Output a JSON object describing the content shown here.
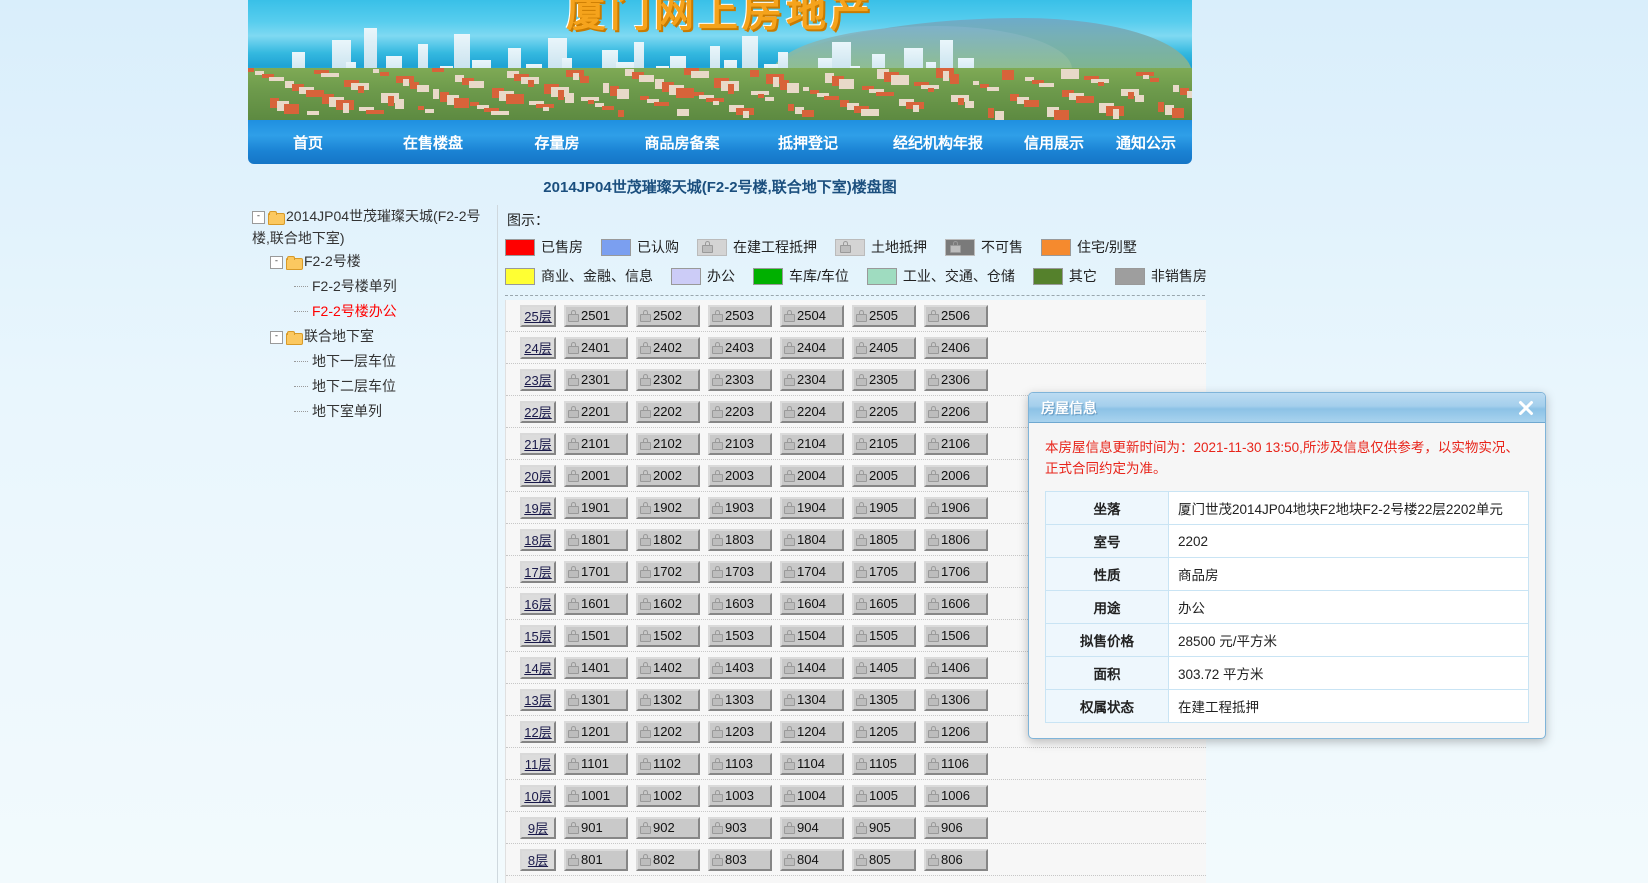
{
  "banner": {
    "title": "厦门网上房地产"
  },
  "nav": {
    "items": [
      {
        "label": "首页",
        "name": "nav-home"
      },
      {
        "label": "在售楼盘",
        "name": "nav-on-sale"
      },
      {
        "label": "存量房",
        "name": "nav-stock-housing"
      },
      {
        "label": "商品房备案",
        "name": "nav-commercial-filing"
      },
      {
        "label": "抵押登记",
        "name": "nav-mortgage-registration"
      },
      {
        "label": "经纪机构年报",
        "name": "nav-agency-annual-report"
      },
      {
        "label": "信用展示",
        "name": "nav-credit-display"
      },
      {
        "label": "通知公示",
        "name": "nav-notices"
      }
    ]
  },
  "page": {
    "title": "2014JP04世茂璀璨天城(F2-2号楼,联合地下室)楼盘图"
  },
  "tree": {
    "root": "2014JP04世茂璀璨天城(F2-2号楼,联合地下室)",
    "expand_glyph": "-",
    "nodes": [
      {
        "label": "F2-2号楼",
        "type": "folder"
      },
      {
        "label": "F2-2号楼单列",
        "type": "leaf",
        "active": false
      },
      {
        "label": "F2-2号楼办公",
        "type": "leaf",
        "active": true
      },
      {
        "label": "联合地下室",
        "type": "folder"
      },
      {
        "label": "地下一层车位",
        "type": "leaf",
        "active": false
      },
      {
        "label": "地下二层车位",
        "type": "leaf",
        "active": false
      },
      {
        "label": "地下室单列",
        "type": "leaf",
        "active": false
      }
    ]
  },
  "legend": {
    "title": "图示：",
    "row1": [
      {
        "label": "已售房",
        "color": "#ff0000",
        "icon": "swatch"
      },
      {
        "label": "已认购",
        "color": "#7b9ff0",
        "icon": "swatch"
      },
      {
        "label": "在建工程抵押",
        "color": "#d4d4d4",
        "icon": "lock-icon"
      },
      {
        "label": "土地抵押",
        "color": "#d4d4d4",
        "icon": "lock-icon"
      },
      {
        "label": "不可售",
        "color": "#7a7a7a",
        "icon": "lock-icon"
      },
      {
        "label": "住宅/别墅",
        "color": "#f58a2e",
        "icon": "swatch"
      }
    ],
    "row2": [
      {
        "label": "商业、金融、信息",
        "color": "#ffff33",
        "icon": "swatch"
      },
      {
        "label": "办公",
        "color": "#ccccf7",
        "icon": "swatch"
      },
      {
        "label": "车库/车位",
        "color": "#00b000",
        "icon": "swatch"
      },
      {
        "label": "工业、交通、仓储",
        "color": "#9fdcc0",
        "icon": "swatch"
      },
      {
        "label": "其它",
        "color": "#55812c",
        "icon": "swatch"
      },
      {
        "label": "非销售房",
        "color": "#9e9e9e",
        "icon": "swatch"
      }
    ]
  },
  "grid": {
    "floor_suffix": "层",
    "rows": [
      {
        "floor": "25层",
        "units": [
          "2501",
          "2502",
          "2503",
          "2504",
          "2505",
          "2506"
        ]
      },
      {
        "floor": "24层",
        "units": [
          "2401",
          "2402",
          "2403",
          "2404",
          "2405",
          "2406"
        ]
      },
      {
        "floor": "23层",
        "units": [
          "2301",
          "2302",
          "2303",
          "2304",
          "2305",
          "2306"
        ]
      },
      {
        "floor": "22层",
        "units": [
          "2201",
          "2202",
          "2203",
          "2204",
          "2205",
          "2206"
        ]
      },
      {
        "floor": "21层",
        "units": [
          "2101",
          "2102",
          "2103",
          "2104",
          "2105",
          "2106"
        ]
      },
      {
        "floor": "20层",
        "units": [
          "2001",
          "2002",
          "2003",
          "2004",
          "2005",
          "2006"
        ]
      },
      {
        "floor": "19层",
        "units": [
          "1901",
          "1902",
          "1903",
          "1904",
          "1905",
          "1906"
        ]
      },
      {
        "floor": "18层",
        "units": [
          "1801",
          "1802",
          "1803",
          "1804",
          "1805",
          "1806"
        ]
      },
      {
        "floor": "17层",
        "units": [
          "1701",
          "1702",
          "1703",
          "1704",
          "1705",
          "1706"
        ]
      },
      {
        "floor": "16层",
        "units": [
          "1601",
          "1602",
          "1603",
          "1604",
          "1605",
          "1606"
        ]
      },
      {
        "floor": "15层",
        "units": [
          "1501",
          "1502",
          "1503",
          "1504",
          "1505",
          "1506"
        ]
      },
      {
        "floor": "14层",
        "units": [
          "1401",
          "1402",
          "1403",
          "1404",
          "1405",
          "1406"
        ]
      },
      {
        "floor": "13层",
        "units": [
          "1301",
          "1302",
          "1303",
          "1304",
          "1305",
          "1306"
        ]
      },
      {
        "floor": "12层",
        "units": [
          "1201",
          "1202",
          "1203",
          "1204",
          "1205",
          "1206"
        ]
      },
      {
        "floor": "11层",
        "units": [
          "1101",
          "1102",
          "1103",
          "1104",
          "1105",
          "1106"
        ]
      },
      {
        "floor": "10层",
        "units": [
          "1001",
          "1002",
          "1003",
          "1004",
          "1005",
          "1006"
        ]
      },
      {
        "floor": "9层",
        "units": [
          "901",
          "902",
          "903",
          "904",
          "905",
          "906"
        ]
      },
      {
        "floor": "8层",
        "units": [
          "801",
          "802",
          "803",
          "804",
          "805",
          "806"
        ]
      }
    ]
  },
  "dialog": {
    "title": "房屋信息",
    "close_icon": "close-icon",
    "note": "本房屋信息更新时间为：2021-11-30 13:50,所涉及信息仅供参考，以实物实况、正式合同约定为准。",
    "fields": [
      {
        "key": "坐落",
        "value": "厦门世茂2014JP04地块F2地块F2-2号楼22层2202单元"
      },
      {
        "key": "室号",
        "value": "2202"
      },
      {
        "key": "性质",
        "value": "商品房"
      },
      {
        "key": "用途",
        "value": "办公"
      },
      {
        "key": "拟售价格",
        "value": "28500 元/平方米"
      },
      {
        "key": "面积",
        "value": "303.72 平方米"
      },
      {
        "key": "权属状态",
        "value": "在建工程抵押"
      }
    ]
  }
}
